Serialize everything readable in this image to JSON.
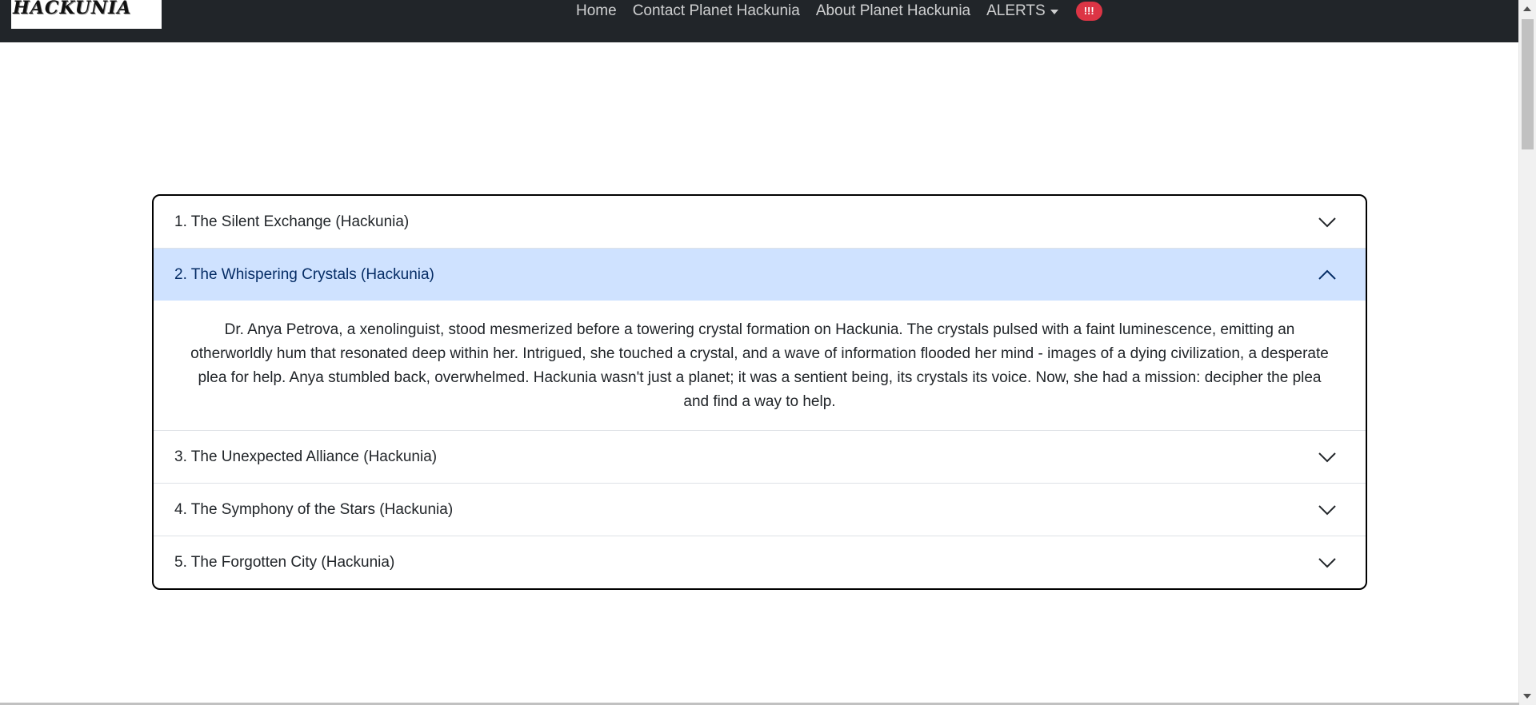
{
  "navbar": {
    "brand": "HACKUNIA",
    "links": [
      {
        "label": "Home"
      },
      {
        "label": "Contact Planet Hackunia"
      },
      {
        "label": "About Planet Hackunia"
      }
    ],
    "alerts_label": "ALERTS",
    "alerts_badge": "!!!"
  },
  "accordion": {
    "items": [
      {
        "title": "1. The Silent Exchange (Hackunia)",
        "expanded": false
      },
      {
        "title": "2. The Whispering Crystals (Hackunia)",
        "expanded": true,
        "body": "Dr. Anya Petrova, a xenolinguist, stood mesmerized before a towering crystal formation on Hackunia. The crystals pulsed with a faint luminescence, emitting an otherworldly hum that resonated deep within her. Intrigued, she touched a crystal, and a wave of information flooded her mind - images of a dying civilization, a desperate plea for help. Anya stumbled back, overwhelmed. Hackunia wasn't just a planet; it was a sentient being, its crystals its voice. Now, she had a mission: decipher the plea and find a way to help."
      },
      {
        "title": "3. The Unexpected Alliance (Hackunia)",
        "expanded": false
      },
      {
        "title": "4. The Symphony of the Stars (Hackunia)",
        "expanded": false
      },
      {
        "title": "5. The Forgotten City (Hackunia)",
        "expanded": false
      }
    ]
  },
  "colors": {
    "navbar_bg": "#212529",
    "active_header_bg": "#cfe2ff",
    "badge_bg": "#dc3545"
  },
  "icons": {
    "collapsed": "chevron-down-icon",
    "expanded": "chevron-up-icon"
  }
}
